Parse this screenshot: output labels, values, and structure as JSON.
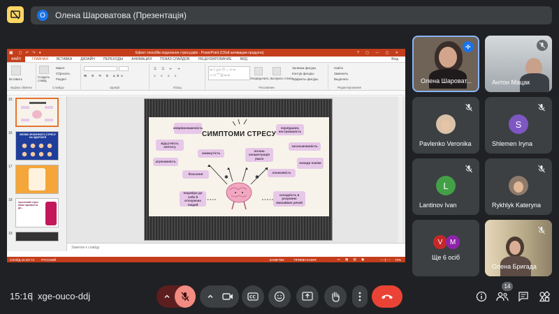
{
  "presenter": {
    "avatar_letter": "О",
    "label": "Олена Шароватова (Презентація)"
  },
  "powerpoint": {
    "title": "Ефект способів подолання стресу.pptx - PowerPoint (Сбой активации продукта)",
    "sign_in": "Вхід",
    "tabs": [
      "ФАЙЛ",
      "ГЛАВНАЯ",
      "ВСТАВКА",
      "ДИЗАЙН",
      "ПЕРЕХОДЫ",
      "АНИМАЦИЯ",
      "ПОКАЗ СЛАЙДОВ",
      "РЕЦЕНЗИРОВАНИЕ",
      "ВИД"
    ],
    "ribbon": {
      "paste": "Вставить",
      "clipboard": "Буфер обмена",
      "create_slide": "Создать слайд",
      "layout": "Макет",
      "reset": "Сбросить",
      "section": "Раздел",
      "slides": "Слайды",
      "font": "Шрифт",
      "paragraph": "Абзац",
      "arrange": "Упорядочить",
      "quick_styles": "Экспресс-стили",
      "shape_fill": "Заливка фигуры",
      "shape_outline": "Контур фигуры",
      "shape_effects": "Эффекты фигуры",
      "drawing": "Рисование",
      "find": "Найти",
      "replace": "Заменить",
      "select": "Выделить",
      "editing": "Редактирование"
    },
    "thumb_numbers": [
      "15",
      "16",
      "17",
      "18",
      "19"
    ],
    "thumb_texts": {
      "t16": "ВПЛИВ ХРОНІЧНОГО СТРЕСУ НА ЗДОРОВ'Я",
      "t18": "Хронічний стрес може призвести до..."
    },
    "notes_placeholder": "Заметки к слайду",
    "status": {
      "slide": "СЛАЙД 15 ИЗ 74",
      "lang": "РУССКИЙ",
      "notes": "ЗАМЕТКИ",
      "comments": "ПРИМЕЧАНИЯ",
      "zoom": "72%"
    }
  },
  "slide": {
    "title": "СИМПТОМИ СТРЕСУ",
    "items": [
      "неврівноваженість",
      "відсутність апетиту",
      "агресивність",
      "замкнутість",
      "безсоння",
      "переїдання, нестриманість",
      "погана концентрація уваги",
      "загальмованість",
      "напади паніки",
      "плаксивість",
      "недовіра до себе й оточуючих людей",
      "складність в розумінні звичайних речей"
    ]
  },
  "participants": [
    {
      "name": "Олена Шароват...",
      "type": "video",
      "speaking": true
    },
    {
      "name": "Антон Мацак",
      "type": "video",
      "muted": true
    },
    {
      "name": "Pavlenko Veronika",
      "type": "photo",
      "muted": true
    },
    {
      "name": "Shlemen Iryna",
      "type": "letter",
      "letter": "S",
      "color": "#7e57c2",
      "muted": true
    },
    {
      "name": "Lantinov Ivan",
      "type": "letter",
      "letter": "L",
      "color": "#43a047",
      "muted": true
    },
    {
      "name": "Rykhlyk Kateryna",
      "type": "photo",
      "muted": true
    },
    {
      "name": "Ще 6 осіб",
      "type": "more",
      "letters": [
        "V",
        "M"
      ]
    },
    {
      "name": "Олена Бригада",
      "type": "video",
      "muted": true
    }
  ],
  "bottom": {
    "time": "15:16",
    "meeting_code": "xge-ouco-ddj",
    "people_count": "14"
  },
  "colors": {
    "accent_red": "#ea4335",
    "badge_yellow": "#fdd663",
    "ppt_orange": "#c43e1c"
  }
}
